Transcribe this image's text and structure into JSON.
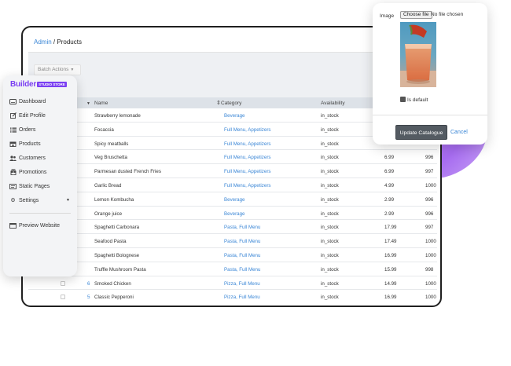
{
  "breadcrumb": {
    "root": "Admin",
    "separator": "/",
    "current": "Products"
  },
  "toolbar": {
    "batch_actions": "Batch Actions"
  },
  "table": {
    "headers": {
      "name": "Name",
      "category": "Category",
      "availability": "Availability"
    },
    "rows": [
      {
        "id": "",
        "name": "Strawberry lemonade",
        "category": "Beverage",
        "availability": "in_stock",
        "price": "",
        "stock": ""
      },
      {
        "id": "",
        "name": "Focaccia",
        "category": "Full Menu, Appetizers",
        "availability": "in_stock",
        "price": "",
        "stock": ""
      },
      {
        "id": "",
        "name": "Spicy meatballs",
        "category": "Full Menu, Appetizers",
        "availability": "in_stock",
        "price": "",
        "stock": ""
      },
      {
        "id": "",
        "name": "Veg Bruschetta",
        "category": "Full Menu, Appetizers",
        "availability": "in_stock",
        "price": "6.99",
        "stock": "996"
      },
      {
        "id": "",
        "name": "Parmesan dusted French Fries",
        "category": "Full Menu, Appetizers",
        "availability": "in_stock",
        "price": "6.99",
        "stock": "997"
      },
      {
        "id": "",
        "name": "Garlic Bread",
        "category": "Full Menu, Appetizers",
        "availability": "in_stock",
        "price": "4.99",
        "stock": "1000"
      },
      {
        "id": "",
        "name": "Lemon Kombucha",
        "category": "Beverage",
        "availability": "in_stock",
        "price": "2.99",
        "stock": "996"
      },
      {
        "id": "",
        "name": "Orange juice",
        "category": "Beverage",
        "availability": "in_stock",
        "price": "2.99",
        "stock": "996"
      },
      {
        "id": "",
        "name": "Spaghetti Carbonara",
        "category": "Pasta, Full Menu",
        "availability": "in_stock",
        "price": "17.99",
        "stock": "997"
      },
      {
        "id": "",
        "name": "Seafood Pasta",
        "category": "Pasta, Full Menu",
        "availability": "in_stock",
        "price": "17.49",
        "stock": "1000"
      },
      {
        "id": "",
        "name": "Spaghetti Bolognese",
        "category": "Pasta, Full Menu",
        "availability": "in_stock",
        "price": "16.99",
        "stock": "1000"
      },
      {
        "id": "",
        "name": "Truffle Mushroom Pasta",
        "category": "Pasta, Full Menu",
        "availability": "in_stock",
        "price": "15.99",
        "stock": "998"
      },
      {
        "id": "6",
        "name": "Smoked Chicken",
        "category": "Pizza, Full Menu",
        "availability": "in_stock",
        "price": "14.99",
        "stock": "1000"
      },
      {
        "id": "5",
        "name": "Classic Pepperoni",
        "category": "Pizza, Full Menu",
        "availability": "in_stock",
        "price": "16.99",
        "stock": "1000"
      }
    ]
  },
  "sidebar": {
    "logo_text": "Builder",
    "logo_badge": "STUDIO STORE",
    "items": [
      {
        "label": "Dashboard",
        "icon": "dashboard-icon"
      },
      {
        "label": "Edit Profile",
        "icon": "edit-icon"
      },
      {
        "label": "Orders",
        "icon": "list-icon"
      },
      {
        "label": "Products",
        "icon": "store-icon"
      },
      {
        "label": "Customers",
        "icon": "users-icon"
      },
      {
        "label": "Promotions",
        "icon": "gift-icon"
      },
      {
        "label": "Static Pages",
        "icon": "page-icon"
      },
      {
        "label": "Settings",
        "icon": "gear-icon"
      }
    ],
    "preview": {
      "label": "Preview Website",
      "icon": "monitor-icon"
    }
  },
  "image_panel": {
    "label": "Image",
    "choose_file": "Choose file",
    "no_file": "No file chosen",
    "is_default": "Is default",
    "update_button": "Update Catalogue",
    "cancel": "Cancel"
  },
  "colors": {
    "accent": "#7b3ff2",
    "link": "#3a86d6",
    "blob": "#a66bf0",
    "button": "#545b62"
  }
}
